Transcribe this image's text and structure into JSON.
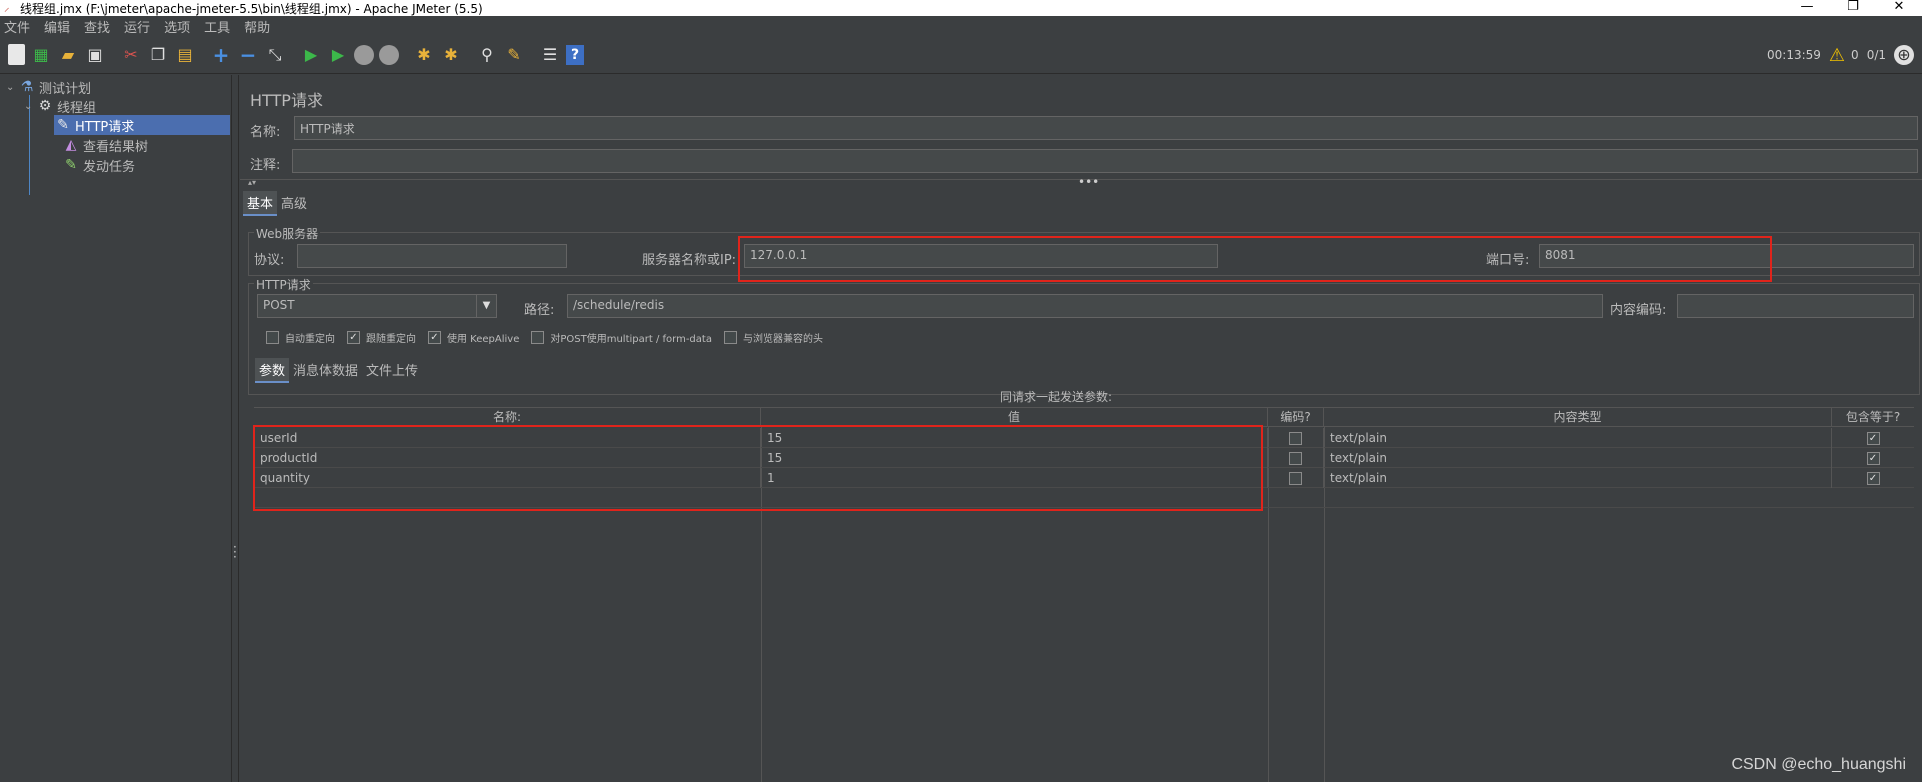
{
  "window": {
    "title": "线程组.jmx (F:\\jmeter\\apache-jmeter-5.5\\bin\\线程组.jmx) - Apache JMeter (5.5)",
    "minimize": "—",
    "restore": "❐",
    "close": "✕"
  },
  "menu": [
    "文件",
    "编辑",
    "查找",
    "运行",
    "选项",
    "工具",
    "帮助"
  ],
  "toolbar": {
    "elapsed": "00:13:59",
    "warnings": "0",
    "threads": "0/1"
  },
  "tree": {
    "items": [
      {
        "label": "测试计划",
        "icon": "flask-icon"
      },
      {
        "label": "线程组",
        "icon": "gear-icon"
      },
      {
        "label": "HTTP请求",
        "icon": "pipette-icon"
      },
      {
        "label": "查看结果树",
        "icon": "chart-icon"
      },
      {
        "label": "发动任务",
        "icon": "pipette-icon"
      }
    ]
  },
  "panel": {
    "title": "HTTP请求",
    "name_label": "名称:",
    "name_value": "HTTP请求",
    "comment_label": "注释:",
    "comment_value": "",
    "tabs": [
      "基本",
      "高级"
    ],
    "web_server_group": "Web服务器",
    "protocol_label": "协议:",
    "protocol_value": "",
    "server_label": "服务器名称或IP:",
    "server_value": "127.0.0.1",
    "port_label": "端口号:",
    "port_value": "8081",
    "http_group": "HTTP请求",
    "method": "POST",
    "path_label": "路径:",
    "path_value": "/schedule/redis",
    "encoding_label": "内容编码:",
    "encoding_value": "",
    "options": [
      {
        "label": "自动重定向",
        "checked": false
      },
      {
        "label": "跟随重定向",
        "checked": true
      },
      {
        "label": "使用 KeepAlive",
        "checked": true
      },
      {
        "label": "对POST使用multipart / form-data",
        "checked": false
      },
      {
        "label": "与浏览器兼容的头",
        "checked": false
      }
    ],
    "param_tabs": [
      "参数",
      "消息体数据",
      "文件上传"
    ],
    "params_caption": "同请求一起发送参数:",
    "check_mark": "✓"
  },
  "table": {
    "headers": [
      "名称:",
      "值",
      "编码?",
      "内容类型",
      "包含等于?"
    ],
    "rows": [
      {
        "name": "userId",
        "value": "15",
        "encode": false,
        "content_type": "text/plain",
        "include_equals": true
      },
      {
        "name": "productId",
        "value": "15",
        "encode": false,
        "content_type": "text/plain",
        "include_equals": true
      },
      {
        "name": "quantity",
        "value": "1",
        "encode": false,
        "content_type": "text/plain",
        "include_equals": true
      }
    ]
  },
  "watermark": "CSDN @echo_huangshi",
  "colors": {
    "background": "#3c3f41",
    "selection": "#4b6eaf",
    "highlight_box": "#e0241b"
  }
}
